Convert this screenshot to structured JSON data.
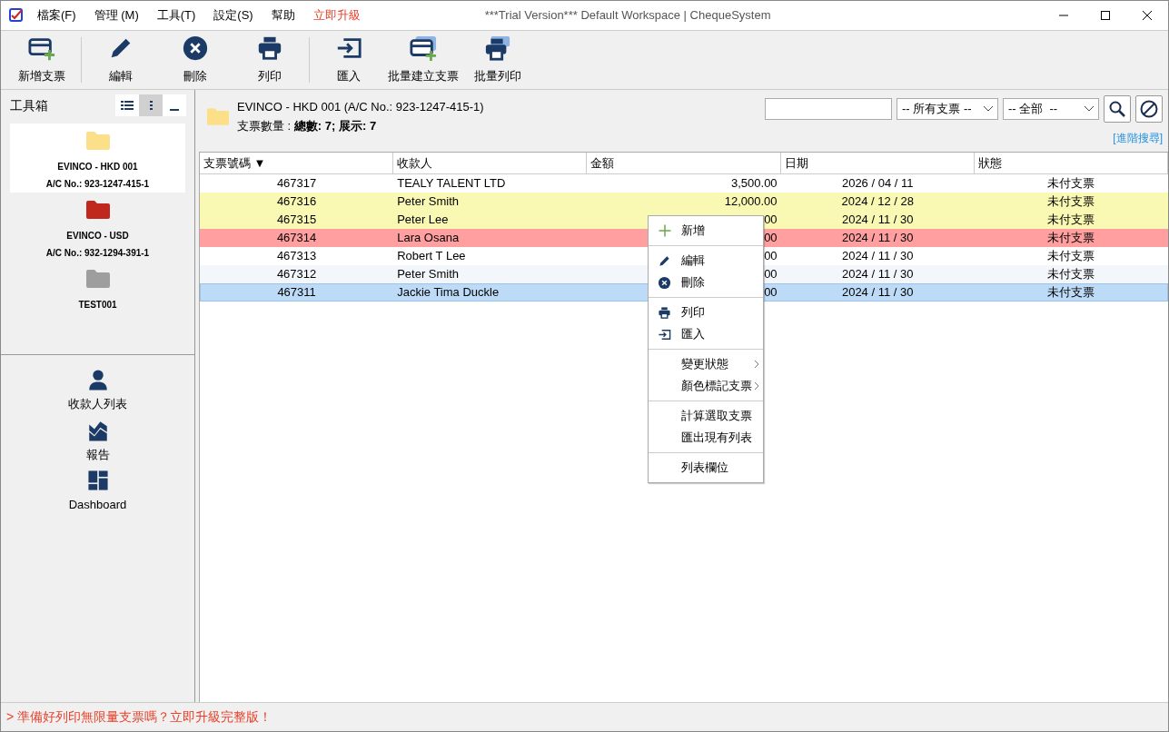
{
  "window": {
    "title": "***Trial Version*** Default Workspace | ChequeSystem"
  },
  "menu_bar": [
    {
      "label": "檔案(F)",
      "kind": "menu"
    },
    {
      "label": "管理 (M)",
      "kind": "menu"
    },
    {
      "label": "工具(T)",
      "kind": "menu"
    },
    {
      "label": "設定(S)",
      "kind": "menu"
    },
    {
      "label": "幫助",
      "kind": "menu"
    },
    {
      "label": "立即升級",
      "kind": "upgrade"
    }
  ],
  "toolbar": [
    [
      {
        "label": "新增支票",
        "kind": "new-cheque"
      }
    ],
    [
      {
        "label": "編輯",
        "kind": "edit"
      },
      {
        "label": "刪除",
        "kind": "delete"
      },
      {
        "label": "列印",
        "kind": "print"
      }
    ],
    [
      {
        "label": "匯入",
        "kind": "import"
      },
      {
        "label": "批量建立支票",
        "kind": "batch-cheque"
      },
      {
        "label": "批量列印",
        "kind": "batch-print"
      }
    ]
  ],
  "toolbox": {
    "title": "工具箱",
    "view_buttons": [
      {
        "kind": "list",
        "selected": false
      },
      {
        "kind": "compact",
        "selected": true
      },
      {
        "kind": "minimize",
        "selected": false
      }
    ],
    "accounts": [
      {
        "name": "EVINCO - HKD 001",
        "account": "A/C No.: 923-1247-415-1",
        "color": "#fbe089",
        "selected": true
      },
      {
        "name": "EVINCO - USD",
        "account": "A/C No.: 932-1294-391-1",
        "color": "#c0281e",
        "selected": false
      },
      {
        "name": "TEST001",
        "color": "#9e9e9e",
        "selected": false
      }
    ]
  },
  "nav": [
    {
      "label": "收款人列表",
      "kind": "person"
    },
    {
      "label": "報告",
      "kind": "chart"
    },
    {
      "label": "Dashboard",
      "kind": "dashboard"
    }
  ],
  "account_header": {
    "title": "EVINCO - HKD 001 (A/C No.: 923-1247-415-1)",
    "summary": "支票數量 : **總數: 7; 展示: 7**"
  },
  "search": {
    "filters": [
      "-- 所有支票 --",
      "-- 全部  --"
    ],
    "advanced_link": "[進階搜尋]"
  },
  "table": {
    "columns": [
      "支票號碼 ▼",
      "收款人",
      "金額",
      "日期",
      "狀態"
    ],
    "rows": [
      {
        "cells": [
          "467317",
          "TEALY TALENT LTD",
          "3,500.00",
          "2026 / 04 / 11",
          "未付支票"
        ],
        "color": "#ffffff",
        "selected": false
      },
      {
        "cells": [
          "467316",
          "Peter Smith",
          "12,000.00",
          "2024 / 12 / 28",
          "未付支票"
        ],
        "color": "#f9f9b4",
        "selected": false
      },
      {
        "cells": [
          "467315",
          "Peter Lee",
          "00",
          "2024 / 11 / 30",
          "未付支票"
        ],
        "color": "#f9f9b4",
        "selected": false
      },
      {
        "cells": [
          "467314",
          "Lara Osana",
          "00",
          "2024 / 11 / 30",
          "未付支票"
        ],
        "color": "#ff9f9f",
        "selected": false
      },
      {
        "cells": [
          "467313",
          "Robert T Lee",
          "00",
          "2024 / 11 / 30",
          "未付支票"
        ],
        "color": "#ffffff",
        "selected": false
      },
      {
        "cells": [
          "467312",
          "Peter Smith",
          "00",
          "2024 / 11 / 30",
          "未付支票"
        ],
        "color": "#f3f6fa",
        "selected": false
      },
      {
        "cells": [
          "467311",
          "Jackie Tima Duckle",
          "00",
          "2024 / 11 / 30",
          "未付支票"
        ],
        "color": "#bddbf6",
        "selected": true
      }
    ]
  },
  "context_menu": [
    [
      {
        "label": "新增",
        "kind": "plus",
        "submenu": false
      }
    ],
    [
      {
        "label": "編輯",
        "kind": "edit",
        "submenu": false
      },
      {
        "label": "刪除",
        "kind": "delete",
        "submenu": false
      }
    ],
    [
      {
        "label": "列印",
        "kind": "print",
        "submenu": false
      },
      {
        "label": "匯入",
        "kind": "import",
        "submenu": false
      }
    ],
    [
      {
        "label": "變更狀態",
        "kind": "text",
        "submenu": true
      },
      {
        "label": "顏色標記支票",
        "kind": "text",
        "submenu": true
      }
    ],
    [
      {
        "label": "計算選取支票",
        "kind": "text",
        "submenu": false
      },
      {
        "label": "匯出現有列表",
        "kind": "text",
        "submenu": false
      }
    ],
    [
      {
        "label": "列表欄位",
        "kind": "text",
        "submenu": false
      }
    ]
  ],
  "status_bar": {
    "message": "> 準備好列印無限量支票嗎？立即升級完整版！"
  }
}
